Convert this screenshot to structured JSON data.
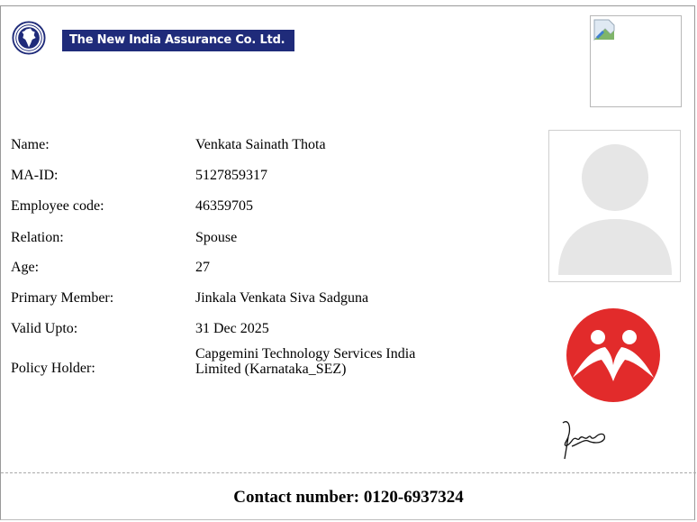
{
  "header": {
    "logo_text": "The New India Assurance Co. Ltd."
  },
  "member": {
    "fields": [
      {
        "label": "Name:",
        "value": "Venkata Sainath Thota"
      },
      {
        "label": "MA-ID:",
        "value": "5127859317"
      },
      {
        "label": "Employee code:",
        "value": "46359705"
      },
      {
        "label": "Relation:",
        "value": "Spouse"
      },
      {
        "label": "Age:",
        "value": "27"
      },
      {
        "label": "Primary Member:",
        "value": "Jinkala Venkata Siva Sadguna"
      },
      {
        "label": "Valid Upto:",
        "value": "31 Dec 2025"
      },
      {
        "label": "Policy Holder:",
        "value_line1": "Capgemini Technology Services India",
        "value_line2": "Limited (Karnataka_SEZ)"
      }
    ]
  },
  "footer": {
    "contact": "Contact number: 0120-6937324"
  },
  "colors": {
    "banner": "#1f2b7a",
    "brand_red": "#e22b2b",
    "avatar_gray": "#e6e6e6"
  },
  "icons": {
    "logo": "insurer-emblem-icon",
    "photo": "broken-image-icon",
    "avatar": "user-avatar-icon",
    "brand": "brand-mark-icon",
    "signature": "signature-icon"
  }
}
